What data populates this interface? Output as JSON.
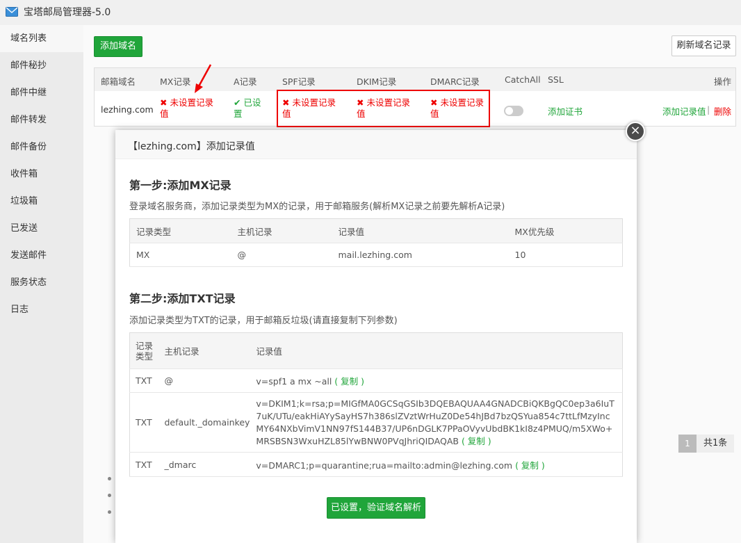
{
  "window": {
    "title": "宝塔邮局管理器-5.0"
  },
  "sidebar": {
    "items": [
      {
        "label": "域名列表"
      },
      {
        "label": "邮件秘抄"
      },
      {
        "label": "邮件中继"
      },
      {
        "label": "邮件转发"
      },
      {
        "label": "邮件备份"
      },
      {
        "label": "收件箱"
      },
      {
        "label": "垃圾箱"
      },
      {
        "label": "已发送"
      },
      {
        "label": "发送邮件"
      },
      {
        "label": "服务状态"
      },
      {
        "label": "日志"
      }
    ]
  },
  "toolbar": {
    "add_domain": "添加域名",
    "refresh": "刷新域名记录"
  },
  "domain_table": {
    "headers": {
      "domain": "邮箱域名",
      "mx": "MX记录",
      "a": "A记录",
      "spf": "SPF记录",
      "dkim": "DKIM记录",
      "dmarc": "DMARC记录",
      "catchall": "CatchAll",
      "ssl": "SSL",
      "ops": "操作"
    },
    "row": {
      "domain": "lezhing.com",
      "mx_line1": "未设置记录",
      "mx_line2": "值",
      "a_line1": "已设",
      "a_line2": "置",
      "spf_line1": "未设置记录",
      "spf_line2": "值",
      "dkim_line1": "未设置记录",
      "dkim_line2": "值",
      "dmarc_line1": "未设置记录",
      "dmarc_line2": "值",
      "ssl": "添加证书",
      "add_record": "添加记录值",
      "separator": "|",
      "delete": "删除"
    }
  },
  "pager": {
    "page": "1",
    "total": "共1条"
  },
  "modal": {
    "title": "【lezhing.com】添加记录值",
    "close": "×",
    "step1": {
      "title": "第一步:添加MX记录",
      "desc": "登录域名服务商，添加记录类型为MX的记录，用于邮箱服务(解析MX记录之前要先解析A记录)",
      "headers": {
        "type": "记录类型",
        "host": "主机记录",
        "value": "记录值",
        "priority": "MX优先级"
      },
      "row": {
        "type": "MX",
        "host": "@",
        "value": "mail.lezhing.com",
        "priority": "10"
      }
    },
    "step2": {
      "title": "第二步:添加TXT记录",
      "desc": "添加记录类型为TXT的记录，用于邮箱反垃圾(请直接复制下列参数)",
      "headers": {
        "type_line1": "记录",
        "type_line2": "类型",
        "host": "主机记录",
        "value": "记录值"
      },
      "rows": [
        {
          "type": "TXT",
          "host": "@",
          "value": "v=spf1 a mx ~all",
          "copy": "( 复制 )"
        },
        {
          "type": "TXT",
          "host": "default._domainkey",
          "value": "v=DKIM1;k=rsa;p=MIGfMA0GCSqGSIb3DQEBAQUAA4GNADCBiQKBgQC0ep3a6IuT7uK/UTu/eakHiAYySayHS7h386slZVztWrHuZ0De54hJBd7bzQSYua854c7ttLfMzyIncMY64NXbVimV1NN97fS144B37/UP6nDGLK7PPaOVyvUbdBK1kI8z4PMUQ/m5XWo+MRSBSN3WxuHZL85lYwBNW0PVqJhriQIDAQAB",
          "copy": "( 复制 )"
        },
        {
          "type": "TXT",
          "host": "_dmarc",
          "value": "v=DMARC1;p=quarantine;rua=mailto:admin@lezhing.com",
          "copy": "( 复制 )"
        }
      ]
    },
    "confirm": "已设置，验证域名解析"
  }
}
